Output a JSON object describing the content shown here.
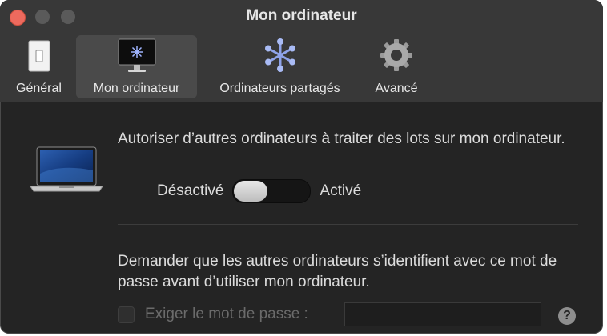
{
  "window": {
    "title": "Mon ordinateur"
  },
  "toolbar": {
    "tabs": [
      {
        "label": "Général",
        "icon": "switch-icon",
        "selected": false
      },
      {
        "label": "Mon ordinateur",
        "icon": "computer-display-icon",
        "selected": true
      },
      {
        "label": "Ordinateurs partagés",
        "icon": "cluster-icon",
        "selected": false
      },
      {
        "label": "Avancé",
        "icon": "gear-icon",
        "selected": false
      }
    ]
  },
  "main": {
    "batch_description": "Autoriser d’autres ordinateurs à traiter des lots sur mon ordinateur.",
    "toggle": {
      "off_label": "Désactivé",
      "on_label": "Activé",
      "state": "off"
    },
    "password_description": "Demander que les autres ordinateurs s’identifient avec ce mot de passe avant d’utiliser mon ordinateur.",
    "require_password": {
      "label": "Exiger le mot de passe :",
      "checked": false,
      "enabled": false,
      "value": ""
    },
    "help_label": "?"
  },
  "colors": {
    "window_bg": "#242424",
    "toolbar_bg": "#383838",
    "close_button": "#ed6a5e",
    "selected_tab_bg": "#4a4a4a",
    "text": "#dcdcdc",
    "disabled_text": "#6b6b6b"
  }
}
